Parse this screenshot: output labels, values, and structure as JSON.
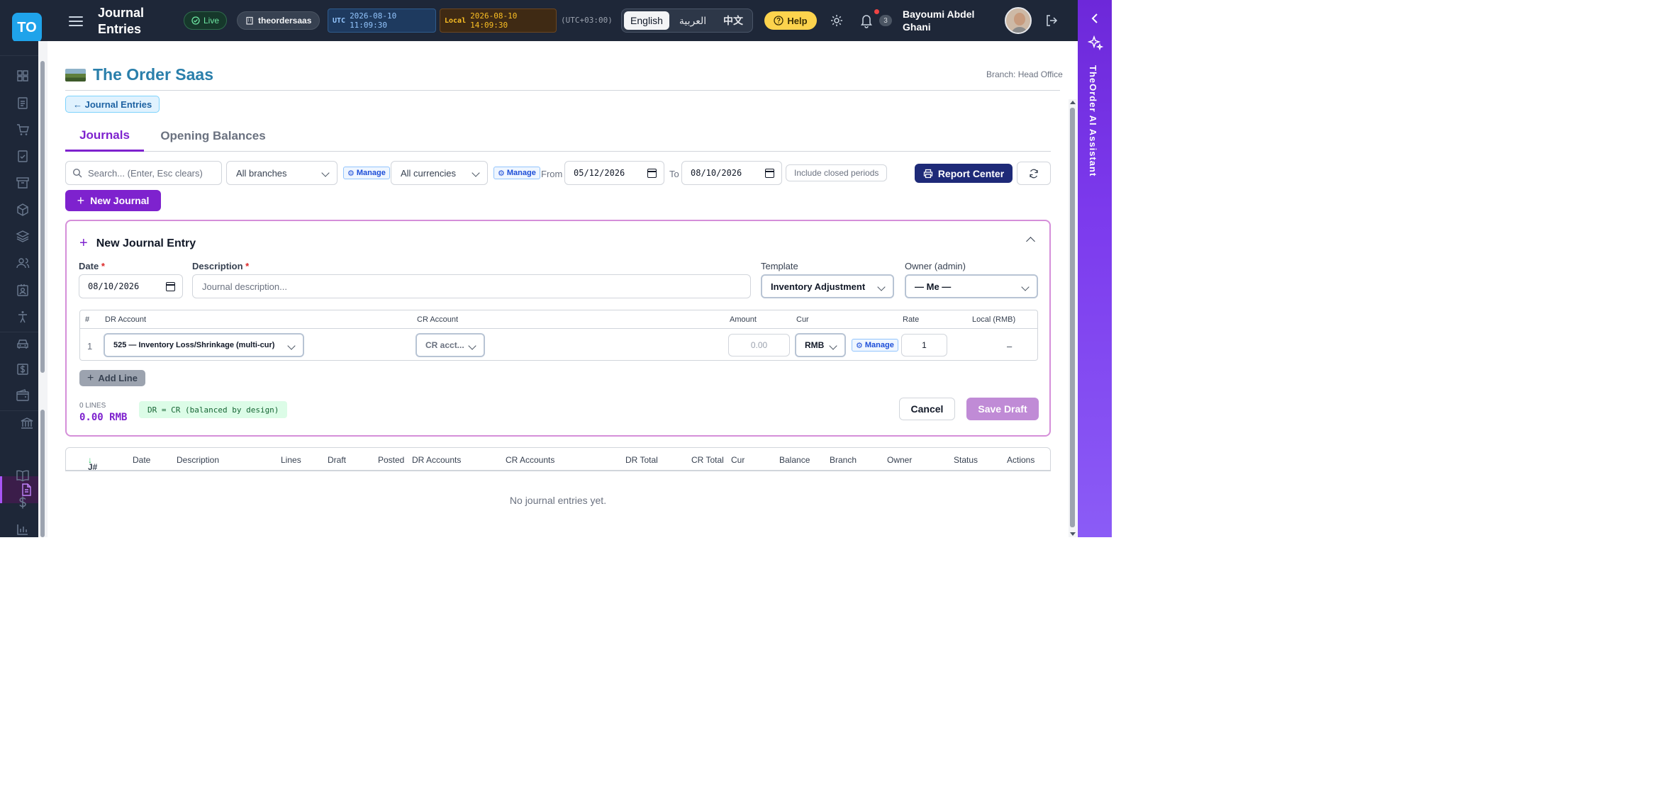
{
  "header": {
    "logo": "TO",
    "title_line1": "Journal",
    "title_line2": "Entries",
    "live": "Live",
    "tenant": "theordersaas",
    "utc_tag": "UTC",
    "utc_date": "2026-08-10",
    "utc_time": "11:09:30",
    "local_tag": "Local",
    "local_date": "2026-08-10",
    "local_time": "14:09:30",
    "offset": "(UTC+03:00)",
    "languages": [
      "English",
      "العربية",
      "中文"
    ],
    "help": "Help",
    "notifications": "3",
    "user_line1": "Bayoumi Abdel",
    "user_line2": "Ghani"
  },
  "ai_panel": {
    "label": "TheOrder AI Assistant"
  },
  "brand": {
    "name": "The Order Saas",
    "branch": "Branch: Head Office"
  },
  "back_label": "← Journal Entries",
  "tabs": [
    "Journals",
    "Opening Balances"
  ],
  "filters": {
    "search_placeholder": "Search... (Enter, Esc clears)",
    "branches": "All branches",
    "manage": "Manage",
    "currencies": "All currencies",
    "from_label": "From",
    "from_date": "05/12/2026",
    "to_label": "To",
    "to_date": "08/10/2026",
    "closed_periods": "Include closed periods",
    "report_center": "Report Center"
  },
  "new_journal": "New Journal",
  "form": {
    "title": "New Journal Entry",
    "date_label": "Date",
    "date_value": "08/10/2026",
    "desc_label": "Description",
    "desc_placeholder": "Journal description...",
    "template_label": "Template",
    "template_value": "Inventory Adjustment",
    "owner_label": "Owner (admin)",
    "owner_value": "— Me —",
    "line_headers": [
      "#",
      "DR Account",
      "CR Account",
      "Amount",
      "Cur",
      "Rate",
      "Local (RMB)"
    ],
    "line": {
      "num": "1",
      "dr": "525 — Inventory Loss/Shrinkage (multi-cur)",
      "cr": "CR acct...",
      "amount_placeholder": "0.00",
      "cur": "RMB",
      "manage": "Manage",
      "rate": "1",
      "local": "–"
    },
    "add_line": "Add Line",
    "lines_count": "0 LINES",
    "total": "0.00 RMB",
    "balanced": "DR = CR (balanced by design)",
    "cancel": "Cancel",
    "save": "Save Draft"
  },
  "table": {
    "headers": [
      "J#",
      "Date",
      "Description",
      "Lines",
      "Draft",
      "Posted",
      "DR Accounts",
      "CR Accounts",
      "DR Total",
      "CR Total",
      "Cur",
      "Balance",
      "Branch",
      "Owner",
      "Status",
      "Actions"
    ],
    "empty": "No journal entries yet."
  }
}
